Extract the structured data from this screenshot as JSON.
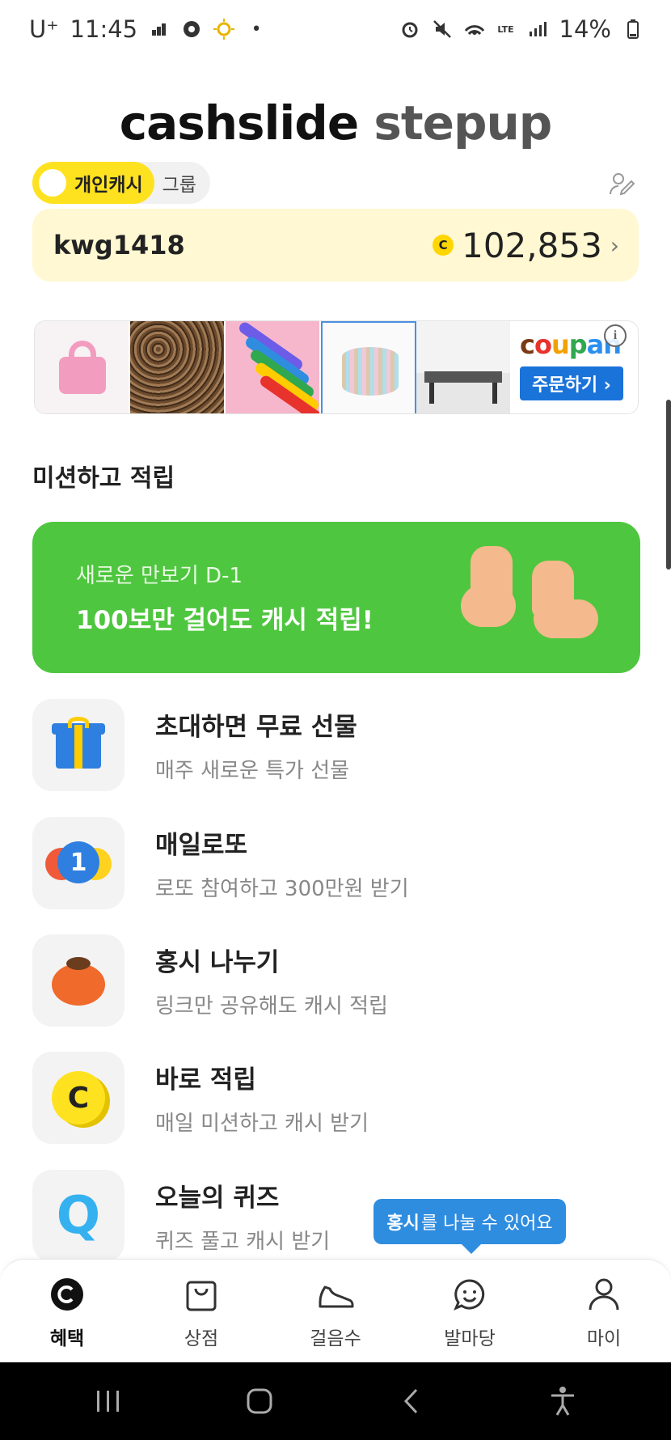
{
  "status_bar": {
    "carrier": "U⁺",
    "time": "11:45",
    "battery": "14%",
    "network": "LTE"
  },
  "brand": {
    "part1": "cashslide",
    "part2": "stepup"
  },
  "toggle": {
    "active": "개인캐시",
    "inactive": "그룹"
  },
  "account": {
    "user_id": "kwg1418",
    "coin_symbol": "C",
    "points": "102,853",
    "chevron": "›"
  },
  "ad": {
    "coupang_logo": [
      "c",
      "o",
      "u",
      "p",
      "an"
    ],
    "coupang_button": "주문하기 ›",
    "info": "i"
  },
  "section": {
    "title": "미션하고 적립"
  },
  "promo": {
    "subtitle": "새로운 만보기 D-1",
    "title": "100보만 걸어도 캐시 적립!"
  },
  "missions": [
    {
      "title": "초대하면 무료 선물",
      "desc": "매주 새로운 특가 선물",
      "icon": "gift-icon"
    },
    {
      "title": "매일로또",
      "desc": "로또 참여하고 300만원 받기",
      "icon": "lotto-ball-icon",
      "ball_number": "1"
    },
    {
      "title": "홍시 나누기",
      "desc": "링크만 공유해도 캐시 적립",
      "icon": "persimmon-icon"
    },
    {
      "title": "바로 적립",
      "desc": "매일 미션하고 캐시 받기",
      "icon": "coin-icon",
      "coin_letter": "C"
    },
    {
      "title": "오늘의 퀴즈",
      "desc": "퀴즈 풀고 캐시 받기",
      "icon": "quiz-icon",
      "quiz_letter": "Q"
    }
  ],
  "tooltip": {
    "bold": "홍시",
    "rest": "를 나눌 수 있어요"
  },
  "bottom_nav": [
    {
      "label": "혜택",
      "icon": "benefit-coin-icon",
      "active": true
    },
    {
      "label": "상점",
      "icon": "shopping-bag-icon",
      "active": false
    },
    {
      "label": "걸음수",
      "icon": "sneaker-icon",
      "active": false
    },
    {
      "label": "발마당",
      "icon": "chat-smile-icon",
      "active": false
    },
    {
      "label": "마이",
      "icon": "person-icon",
      "active": false
    }
  ],
  "colors": {
    "accent_yellow": "#ffe21f",
    "balance_bg": "#fff8d2",
    "promo_green": "#4fc63f",
    "tooltip_blue": "#2f8de0"
  }
}
